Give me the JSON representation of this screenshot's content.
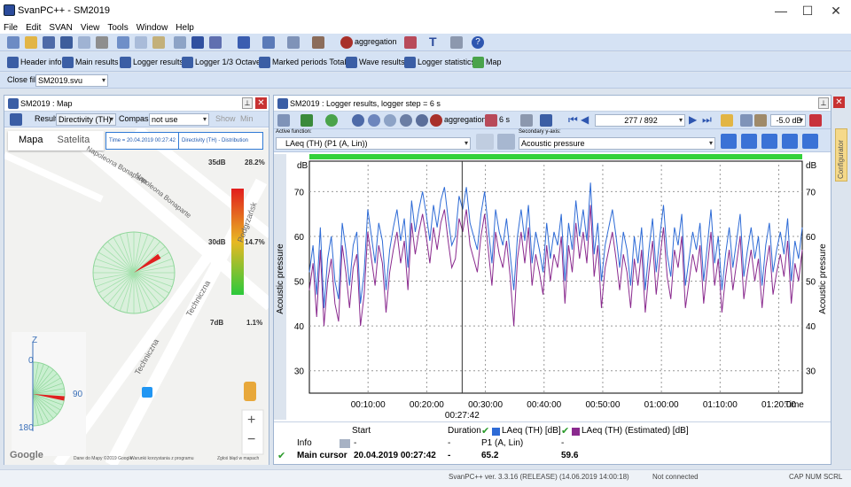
{
  "window": {
    "title": "SvanPC++ - SM2019"
  },
  "menu": [
    "File",
    "Edit",
    "SVAN",
    "View",
    "Tools",
    "Window",
    "Help"
  ],
  "toolbar": {
    "aggregation": "aggregation",
    "text_tool": "T",
    "help": "?"
  },
  "views": [
    "Header info",
    "Main results",
    "Logger results",
    "Logger 1/3 Octave",
    "Marked periods Totals",
    "Wave results",
    "Logger statistics",
    "Map"
  ],
  "close_file": {
    "label": "Close file:",
    "value": "SM2019.svu"
  },
  "map_pane": {
    "title": "SM2019 : Map",
    "result_label": "Result",
    "result_value": "Directivity (TH)",
    "compass_label": "Compass",
    "compass_value": "not use",
    "show_label": "Show",
    "min_label": "Min",
    "tabs": [
      "Mapa",
      "Satelita"
    ],
    "time_box": "Time = 20.04.2019 00:27:42",
    "mode_box": "Directivity (TH) - Distribution",
    "streets": [
      "Napoleona Bonaparte",
      "Napoleona Bonaparte",
      "Techniczna",
      "Techniczna",
      "Podgrzańsk"
    ],
    "scale_labels": [
      "35dB",
      "30dB",
      "7dB"
    ],
    "scale_percent": [
      "28.2%",
      "14.7%",
      "1.1%"
    ],
    "compass_labels": {
      "z": "Z",
      "zero": "0",
      "ninety": "90",
      "oneeighty": "180"
    },
    "zoom_in": "+",
    "zoom_out": "−",
    "google": "Google",
    "footer": [
      "Dane do Mapy ©2019 Google",
      "Warunki korzystania z programu",
      "Zgłoś błąd w mapach"
    ],
    "directivity_level": 0.75
  },
  "logger_pane": {
    "title": "SM2019 : Logger results, logger step = 6 s",
    "aggregation": "aggregation",
    "step_value": "6 s",
    "counter": "277 / 892",
    "offset": "-5.0 dB",
    "active_function_label": "Active function:",
    "active_function_value": "LAeq (TH) (P1 (A, Lin))",
    "secondary_label": "Secondary y-axis:",
    "secondary_value": "Acoustic pressure",
    "configurator": "Configurator"
  },
  "chart_data": {
    "type": "line",
    "ylabel": "Acoustic pressure",
    "y2label": "Acoustic pressure",
    "yunit": "dB",
    "ylim": [
      25,
      76
    ],
    "yticks": [
      30,
      40,
      50,
      60,
      70
    ],
    "xticks": [
      "00:10:00",
      "00:20:00",
      "00:30:00",
      "00:40:00",
      "00:50:00",
      "01:00:00",
      "01:10:00",
      "01:20:00"
    ],
    "xlabel": "Time",
    "cursor_label": "00:27:42",
    "cursor_fraction": 0.31,
    "series": [
      {
        "name": "LAeq (TH) [dB]",
        "color": "#2e6bd6",
        "values": [
          52,
          58,
          47,
          62,
          44,
          55,
          60,
          50,
          46,
          63,
          57,
          49,
          58,
          61,
          45,
          52,
          66,
          60,
          54,
          63,
          59,
          48,
          57,
          62,
          66,
          59,
          64,
          53,
          68,
          61,
          66,
          70,
          65,
          59,
          67,
          62,
          68,
          71,
          64,
          58,
          60,
          69,
          66,
          71,
          63,
          60,
          57,
          65,
          70,
          62,
          54,
          66,
          61,
          58,
          64,
          56,
          48,
          60,
          66,
          59,
          67,
          54,
          61,
          57,
          52,
          63,
          55,
          61,
          58,
          65,
          50,
          63,
          57,
          68,
          60,
          66,
          59,
          72,
          56,
          63,
          50,
          58,
          62,
          66,
          60,
          53,
          61,
          57,
          49,
          60,
          54,
          62,
          48,
          57,
          64,
          52,
          60,
          67,
          56,
          51,
          62,
          58,
          65,
          49,
          55,
          61,
          57,
          63,
          50,
          58,
          66,
          54,
          60,
          48,
          56,
          62,
          53,
          59,
          65,
          51,
          57,
          62,
          55,
          60,
          49,
          58,
          63,
          52,
          57,
          61,
          56,
          64,
          50,
          59,
          55,
          62
        ]
      },
      {
        "name": "LAeq (TH) (Estimated) [dB]",
        "color": "#8a2a8e",
        "values": [
          48,
          54,
          42,
          57,
          40,
          50,
          55,
          45,
          41,
          58,
          52,
          44,
          53,
          56,
          40,
          47,
          61,
          55,
          49,
          58,
          54,
          43,
          52,
          57,
          61,
          54,
          59,
          48,
          63,
          56,
          61,
          65,
          60,
          54,
          62,
          57,
          63,
          66,
          59,
          53,
          55,
          64,
          61,
          66,
          58,
          55,
          52,
          60,
          65,
          57,
          49,
          61,
          56,
          53,
          59,
          51,
          40,
          55,
          61,
          54,
          62,
          49,
          56,
          52,
          47,
          58,
          50,
          56,
          53,
          60,
          45,
          58,
          52,
          63,
          55,
          61,
          54,
          67,
          51,
          58,
          44,
          53,
          57,
          61,
          55,
          48,
          56,
          52,
          44,
          55,
          49,
          57,
          43,
          52,
          59,
          47,
          55,
          62,
          51,
          46,
          57,
          53,
          60,
          44,
          50,
          56,
          52,
          58,
          45,
          53,
          61,
          49,
          55,
          43,
          51,
          57,
          48,
          54,
          60,
          46,
          52,
          57,
          50,
          55,
          44,
          53,
          58,
          47,
          52,
          56,
          51,
          59,
          45,
          54,
          50,
          57
        ]
      }
    ]
  },
  "results_table": {
    "headers": {
      "start": "Start",
      "duration": "Duration",
      "col1": "LAeq (TH) [dB]",
      "col2": "LAeq (TH) (Estimated) [dB]"
    },
    "info_row": {
      "label": "Info",
      "start": "-",
      "duration": "-",
      "col1": "P1 (A, Lin)",
      "col2": "-"
    },
    "cursor_row": {
      "label": "Main cursor",
      "start": "20.04.2019 00:27:42",
      "duration": "-",
      "col1": "65.2",
      "col2": "59.6"
    }
  },
  "status": {
    "version": "SvanPC++ ver. 3.3.16 (RELEASE) (14.06.2019 14:00:18)",
    "connection": "Not connected",
    "keys": "CAP NUM SCRL"
  }
}
